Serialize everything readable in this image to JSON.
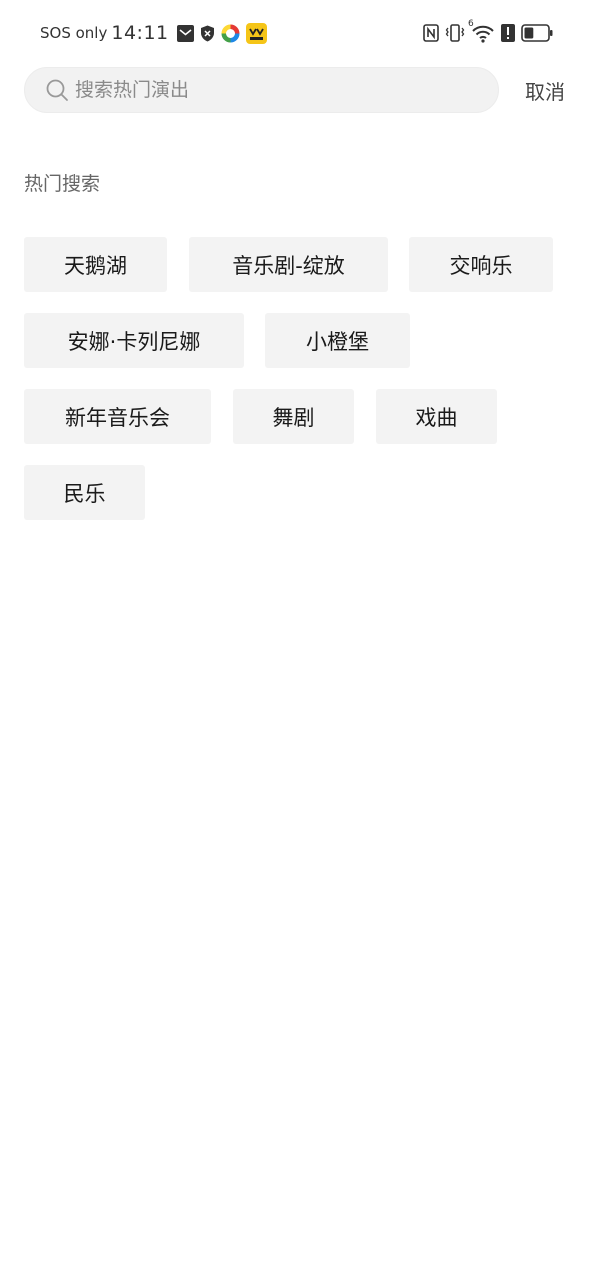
{
  "status_bar": {
    "carrier": "SOS only",
    "time": "14:11",
    "icons_left": [
      "mail-icon",
      "shield-x-icon",
      "colorful-app-icon",
      "yellow-app-icon"
    ],
    "icons_right": [
      "nfc-icon",
      "vibrate-icon",
      "wifi-icon",
      "alert-icon",
      "battery-icon"
    ],
    "wifi_label": "6",
    "battery_level": 0.4
  },
  "search": {
    "placeholder": "搜索热门演出",
    "value": "",
    "cancel_label": "取消"
  },
  "hot_search": {
    "title": "热门搜索",
    "tags": [
      "天鹅湖",
      "音乐剧-绽放",
      "交响乐",
      "安娜·卡列尼娜",
      "小橙堡",
      "新年音乐会",
      "舞剧",
      "戏曲",
      "民乐"
    ]
  },
  "colors": {
    "background": "#ffffff",
    "tag_background": "#f3f3f3",
    "search_background": "#f2f2f2",
    "text_primary": "#1a1a1a",
    "text_secondary": "#666666"
  }
}
